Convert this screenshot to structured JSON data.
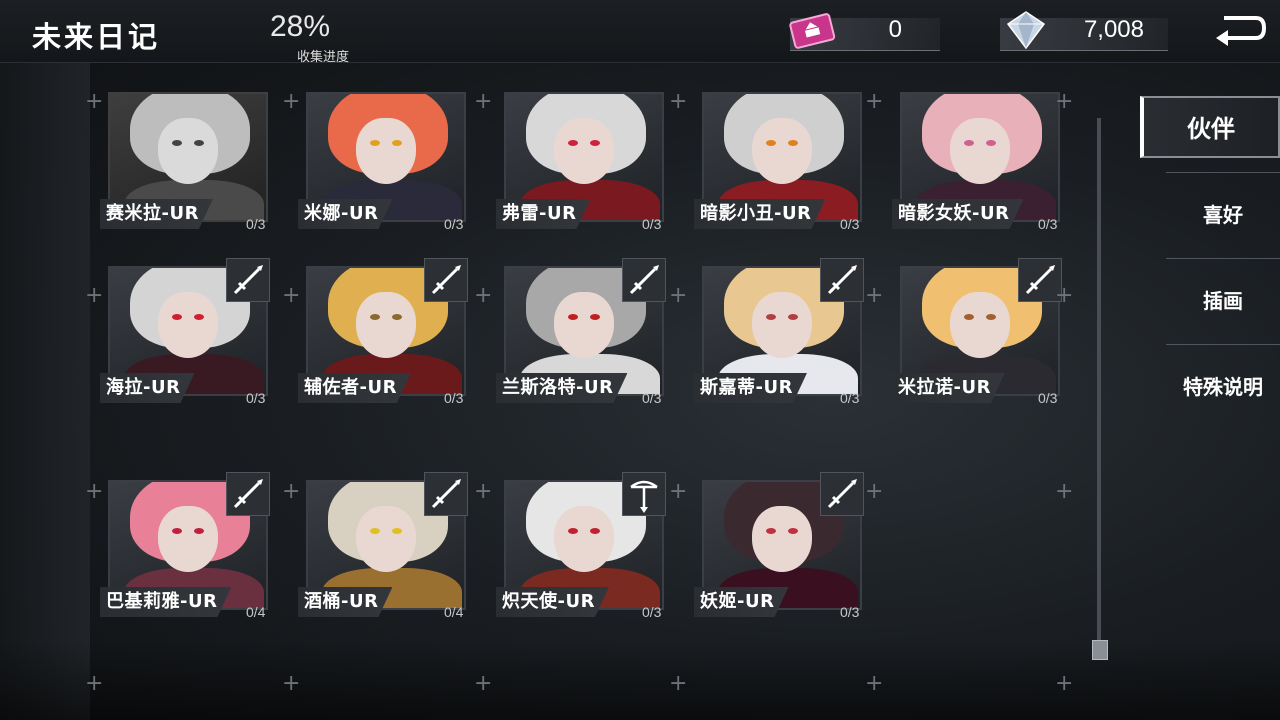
{
  "header": {
    "title": "未来日记",
    "progress_value": "28%",
    "progress_label": "收集进度",
    "ticket_count": "0",
    "gem_count": "7,008"
  },
  "tabs": [
    {
      "label": "伙伴",
      "active": true
    },
    {
      "label": "喜好",
      "active": false
    },
    {
      "label": "插画",
      "active": false
    },
    {
      "label": "特殊说明",
      "active": false
    }
  ],
  "characters": [
    {
      "name": "赛米拉-UR",
      "count": "0/3",
      "weapon": "",
      "hair": "#bdbdbd",
      "body": "#4a4a4a",
      "eye": "#c02030",
      "grey": true
    },
    {
      "name": "米娜-UR",
      "count": "0/3",
      "weapon": "",
      "hair": "#e86a4a",
      "body": "#2a2a3a",
      "eye": "#e0a020"
    },
    {
      "name": "弗雷-UR",
      "count": "0/3",
      "weapon": "",
      "hair": "#d8d8d8",
      "body": "#7a1a20",
      "eye": "#d02040"
    },
    {
      "name": "暗影小丑-UR",
      "count": "0/3",
      "weapon": "",
      "hair": "#cfcfcf",
      "body": "#8a1c22",
      "eye": "#e08020"
    },
    {
      "name": "暗影女妖-UR",
      "count": "0/3",
      "weapon": "",
      "hair": "#e8b0b8",
      "body": "#3a2030",
      "eye": "#d06090"
    },
    {
      "name": "海拉-UR",
      "count": "0/3",
      "weapon": "sword",
      "hair": "#d4d4d4",
      "body": "#3a1a22",
      "eye": "#d02030"
    },
    {
      "name": "辅佐者-UR",
      "count": "0/3",
      "weapon": "sword",
      "hair": "#e0b050",
      "body": "#6a1a1a",
      "eye": "#8a6a30"
    },
    {
      "name": "兰斯洛特-UR",
      "count": "0/3",
      "weapon": "sword",
      "hair": "#a8a8a8",
      "body": "#d8d8d8",
      "eye": "#c02020"
    },
    {
      "name": "斯嘉蒂-UR",
      "count": "0/3",
      "weapon": "sword",
      "hair": "#e8c890",
      "body": "#e6e8ee",
      "eye": "#b04040"
    },
    {
      "name": "米拉诺-UR",
      "count": "0/3",
      "weapon": "sword",
      "hair": "#f0c070",
      "body": "#2a2a30",
      "eye": "#a06030"
    },
    {
      "name": "巴基莉雅-UR",
      "count": "0/4",
      "weapon": "sword",
      "hair": "#e88098",
      "body": "#6a3040",
      "eye": "#c02040"
    },
    {
      "name": "酒桶-UR",
      "count": "0/4",
      "weapon": "sword",
      "hair": "#d8d0c0",
      "body": "#9a7030",
      "eye": "#e0c020"
    },
    {
      "name": "炽天使-UR",
      "count": "0/3",
      "weapon": "bow",
      "hair": "#e6e6e6",
      "body": "#7a2a20",
      "eye": "#c02030"
    },
    {
      "name": "妖姬-UR",
      "count": "0/3",
      "weapon": "sword",
      "hair": "#3a2a30",
      "body": "#3a1020",
      "eye": "#c03040"
    }
  ]
}
